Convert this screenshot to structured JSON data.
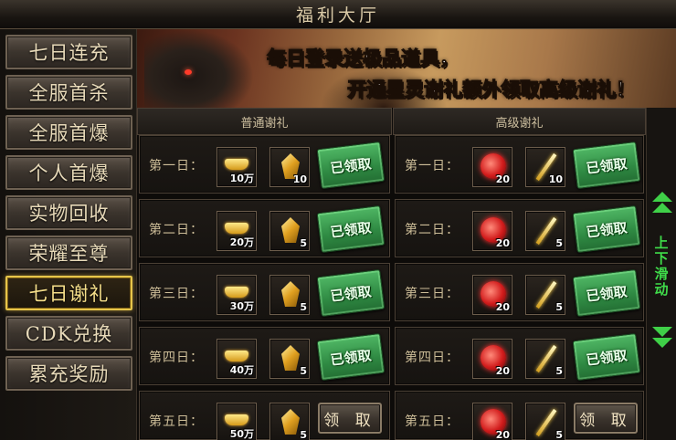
{
  "window": {
    "title": "福利大厅"
  },
  "sidebar": {
    "items": [
      {
        "label": "七日连充"
      },
      {
        "label": "全服首杀"
      },
      {
        "label": "全服首爆"
      },
      {
        "label": "个人首爆"
      },
      {
        "label": "实物回收"
      },
      {
        "label": "荣耀至尊"
      },
      {
        "label": "七日谢礼",
        "active": true
      },
      {
        "label": "CDK兑换"
      },
      {
        "label": "累充奖励"
      }
    ]
  },
  "banner": {
    "line1": "每日登录送极品道具，",
    "line2": "开通星灵谢礼额外领取高级谢礼！"
  },
  "columns": {
    "normal": "普通谢礼",
    "advanced": "高级谢礼"
  },
  "scroll": {
    "label": "上下滑动",
    "up_icon": "double-chevron-up-icon",
    "down_icon": "double-chevron-down-icon",
    "color": "#3fd048"
  },
  "days": [
    {
      "day": "第一日：",
      "normal": {
        "gold": "10万",
        "crystal": "10",
        "status": "已领取"
      },
      "advanced": {
        "orb": "20",
        "sword": "10",
        "status": "已领取"
      }
    },
    {
      "day": "第二日：",
      "normal": {
        "gold": "20万",
        "crystal": "5",
        "status": "已领取"
      },
      "advanced": {
        "orb": "20",
        "sword": "5",
        "status": "已领取"
      }
    },
    {
      "day": "第三日：",
      "normal": {
        "gold": "30万",
        "crystal": "5",
        "status": "已领取"
      },
      "advanced": {
        "orb": "20",
        "sword": "5",
        "status": "已领取"
      }
    },
    {
      "day": "第四日：",
      "normal": {
        "gold": "40万",
        "crystal": "5",
        "status": "已领取"
      },
      "advanced": {
        "orb": "20",
        "sword": "5",
        "status": "已领取"
      }
    },
    {
      "day": "第五日：",
      "normal": {
        "gold": "50万",
        "crystal": "5",
        "status": "领 取"
      },
      "advanced": {
        "orb": "20",
        "sword": "5",
        "status": "领 取"
      }
    }
  ]
}
